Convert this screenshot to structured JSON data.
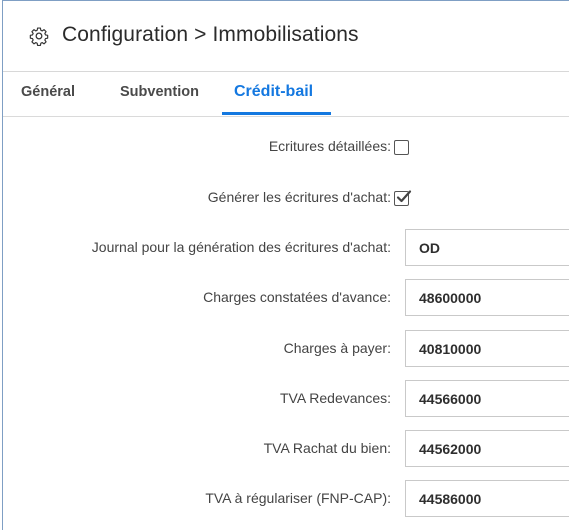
{
  "header": {
    "title": "Configuration > Immobilisations",
    "icon": "gear-icon"
  },
  "tabs": [
    {
      "label": "Général",
      "active": false
    },
    {
      "label": "Subvention",
      "active": false
    },
    {
      "label": "Crédit-bail",
      "active": true
    }
  ],
  "colors": {
    "accent": "#1478e0",
    "frame_border": "#7f9fc4"
  },
  "form": {
    "ecritures_detaillees": {
      "label": "Ecritures détaillées:",
      "checked": false
    },
    "generer_ecritures_achat": {
      "label": "Générer les écritures d'achat:",
      "checked": true
    },
    "journal": {
      "label": "Journal pour la génération des écritures d'achat:",
      "value": "OD"
    },
    "charges_constatees": {
      "label": "Charges constatées d'avance:",
      "value": "48600000"
    },
    "charges_a_payer": {
      "label": "Charges à payer:",
      "value": "40810000"
    },
    "tva_redevances": {
      "label": "TVA Redevances:",
      "value": "44566000"
    },
    "tva_rachat": {
      "label": "TVA Rachat du bien:",
      "value": "44562000"
    },
    "tva_regulariser": {
      "label": "TVA à régulariser (FNP-CAP):",
      "value": "44586000"
    }
  }
}
